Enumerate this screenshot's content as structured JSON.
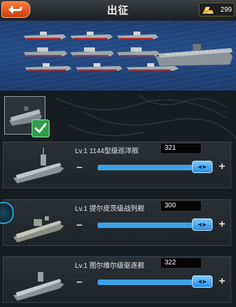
{
  "header": {
    "title": "出征",
    "gold_amount": "299"
  },
  "ships": [
    {
      "label": "Lv.1 1144型级巡洋舰",
      "count": "321",
      "slider_fraction": 0.97
    },
    {
      "label": "Lv.1 提尔皮茨级战列舰",
      "count": "300",
      "slider_fraction": 0.97
    },
    {
      "label": "Lv.1 图尔维尔级驱逐舰",
      "count": "322",
      "slider_fraction": 0.97
    }
  ],
  "colors": {
    "accent_orange": "#e05a1c",
    "slider_blue": "#3ea0e8",
    "check_green": "#2f9d4a"
  },
  "icons": {
    "back": "back-arrow-icon",
    "gold": "gold-bars-icon",
    "check": "checkmark-icon"
  }
}
